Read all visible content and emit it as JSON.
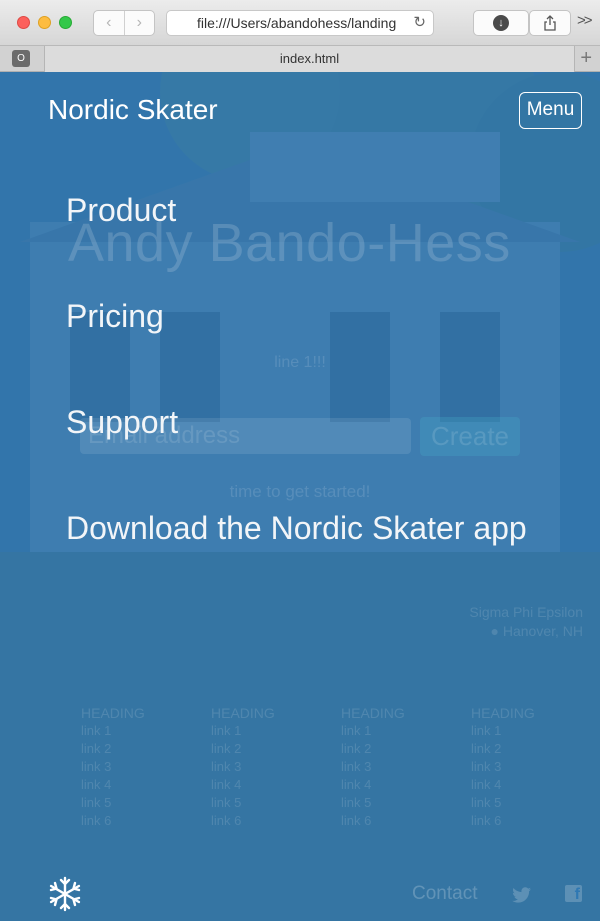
{
  "browser": {
    "url": "file:///Users/abandohess/landing",
    "tab_title": "index.html",
    "tab_icon": "O"
  },
  "nav": {
    "brand": "Nordic Skater",
    "menu_label": "Menu",
    "menu_items": [
      {
        "label": "Product"
      },
      {
        "label": "Pricing"
      },
      {
        "label": "Support"
      },
      {
        "label": "Download the Nordic Skater app"
      }
    ]
  },
  "background": {
    "title": "Andy Bando-Hess",
    "line": "line 1!!!",
    "email_placeholder": "Email address",
    "create_label": "Create",
    "started": "time to get started!",
    "address_line1": "Sigma Phi Epsilon",
    "address_line2": "Hanover, NH"
  },
  "footer": {
    "columns": [
      {
        "heading": "HEADING",
        "links": [
          "link 1",
          "link 2",
          "link 3",
          "link 4",
          "link 5",
          "link 6"
        ]
      },
      {
        "heading": "HEADING",
        "links": [
          "link 1",
          "link 2",
          "link 3",
          "link 4",
          "link 5",
          "link 6"
        ]
      },
      {
        "heading": "HEADING",
        "links": [
          "link 1",
          "link 2",
          "link 3",
          "link 4",
          "link 5",
          "link 6"
        ]
      },
      {
        "heading": "HEADING",
        "links": [
          "link 1",
          "link 2",
          "link 3",
          "link 4",
          "link 5",
          "link 6"
        ]
      }
    ],
    "contact_label": "Contact"
  },
  "icons": {
    "logo": "snowflake-icon",
    "twitter": "twitter-icon",
    "facebook": "facebook-icon",
    "location": "map-pin-icon"
  },
  "colors": {
    "overlay": "#2f78b3",
    "text": "#ffffff"
  }
}
